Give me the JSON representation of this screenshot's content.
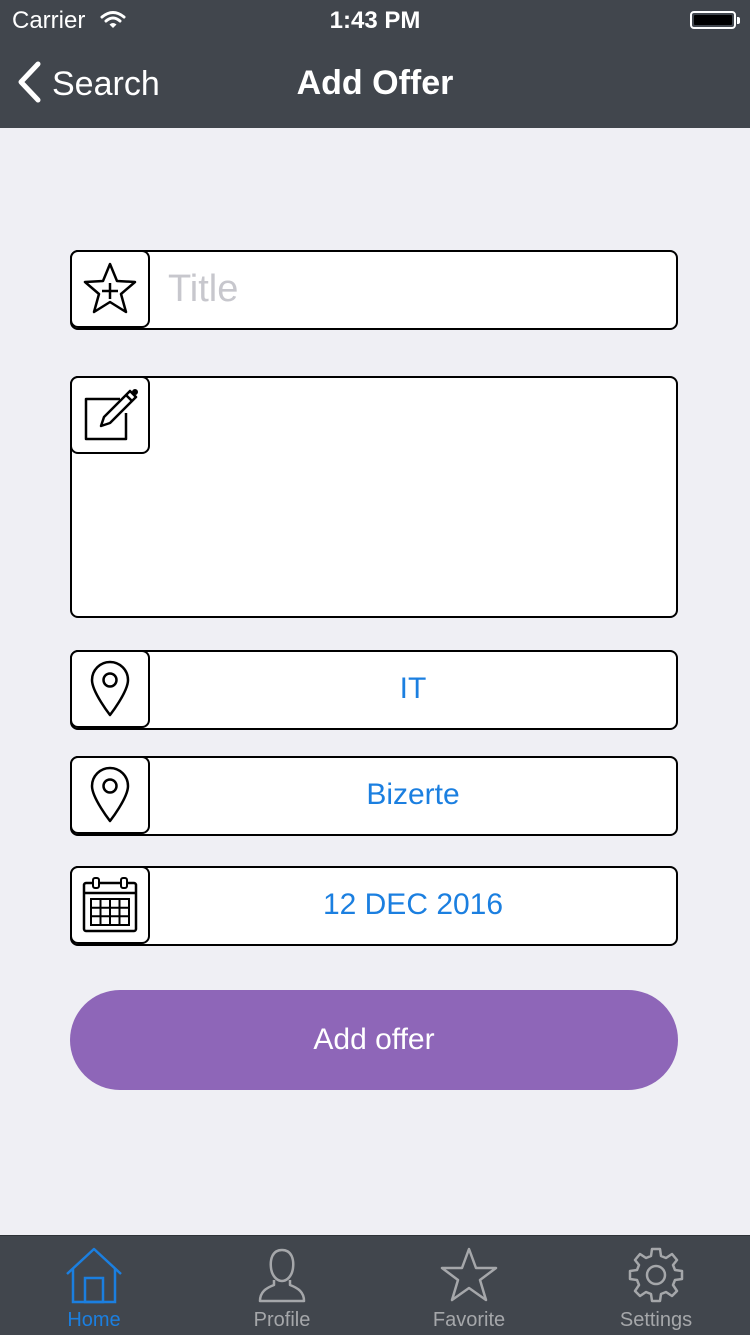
{
  "status_bar": {
    "carrier": "Carrier",
    "time": "1:43 PM"
  },
  "nav": {
    "back_label": "Search",
    "title": "Add Offer"
  },
  "form": {
    "title_placeholder": "Title",
    "title_value": "",
    "description_value": "",
    "category": "IT",
    "city": "Bizerte",
    "date": "12 DEC 2016",
    "submit_label": "Add offer"
  },
  "tabs": [
    {
      "label": "Home",
      "icon": "home-icon",
      "active": true
    },
    {
      "label": "Profile",
      "icon": "person-icon",
      "active": false
    },
    {
      "label": "Favorite",
      "icon": "star-icon",
      "active": false
    },
    {
      "label": "Settings",
      "icon": "gear-icon",
      "active": false
    }
  ],
  "colors": {
    "bar_background": "#41464D",
    "page_background": "#EFEFF4",
    "accent_blue": "#1B7FE0",
    "button_purple": "#8E66B8",
    "tab_inactive": "#A5A7AA"
  }
}
